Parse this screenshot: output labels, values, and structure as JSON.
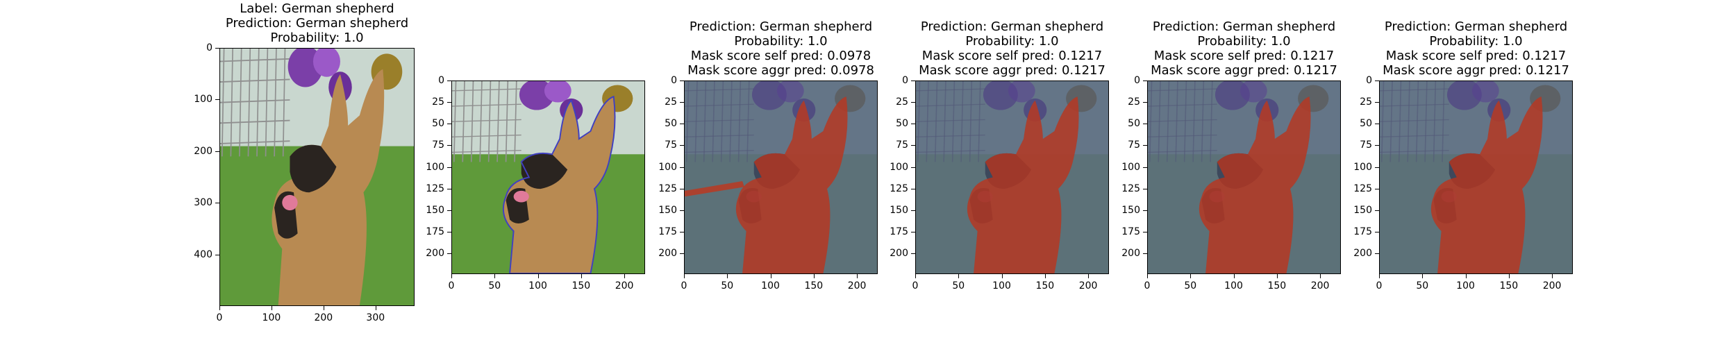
{
  "panels": [
    {
      "title_lines": [
        "Label: German shepherd",
        "Prediction: German shepherd",
        "Probability: 1.0"
      ],
      "x_ticks": [
        "0",
        "100",
        "200",
        "300"
      ],
      "x_tick_values": [
        0,
        100,
        200,
        300
      ],
      "x_max": 375,
      "y_ticks": [
        "0",
        "100",
        "200",
        "300",
        "400"
      ],
      "y_tick_values": [
        0,
        100,
        200,
        300,
        400
      ],
      "y_max": 500,
      "overlay": "none"
    },
    {
      "title_lines": [],
      "x_ticks": [
        "0",
        "50",
        "100",
        "150",
        "200"
      ],
      "x_tick_values": [
        0,
        50,
        100,
        150,
        200
      ],
      "x_max": 224,
      "y_ticks": [
        "0",
        "25",
        "50",
        "75",
        "100",
        "125",
        "150",
        "175",
        "200"
      ],
      "y_tick_values": [
        0,
        25,
        50,
        75,
        100,
        125,
        150,
        175,
        200
      ],
      "y_max": 224,
      "overlay": "edges"
    },
    {
      "title_lines": [
        "Prediction: German shepherd",
        "Probability: 1.0",
        "Mask score self pred: 0.0978",
        "Mask score aggr pred: 0.0978"
      ],
      "x_ticks": [
        "0",
        "50",
        "100",
        "150",
        "200"
      ],
      "x_tick_values": [
        0,
        50,
        100,
        150,
        200
      ],
      "x_max": 224,
      "y_ticks": [
        "0",
        "25",
        "50",
        "75",
        "100",
        "125",
        "150",
        "175",
        "200"
      ],
      "y_tick_values": [
        0,
        25,
        50,
        75,
        100,
        125,
        150,
        175,
        200
      ],
      "y_max": 224,
      "overlay": "mask-leash"
    },
    {
      "title_lines": [
        "Prediction: German shepherd",
        "Probability: 1.0",
        "Mask score self pred: 0.1217",
        "Mask score aggr pred: 0.1217"
      ],
      "x_ticks": [
        "0",
        "50",
        "100",
        "150",
        "200"
      ],
      "x_tick_values": [
        0,
        50,
        100,
        150,
        200
      ],
      "x_max": 224,
      "y_ticks": [
        "0",
        "25",
        "50",
        "75",
        "100",
        "125",
        "150",
        "175",
        "200"
      ],
      "y_tick_values": [
        0,
        25,
        50,
        75,
        100,
        125,
        150,
        175,
        200
      ],
      "y_max": 224,
      "overlay": "mask"
    },
    {
      "title_lines": [
        "Prediction: German shepherd",
        "Probability: 1.0",
        "Mask score self pred: 0.1217",
        "Mask score aggr pred: 0.1217"
      ],
      "x_ticks": [
        "0",
        "50",
        "100",
        "150",
        "200"
      ],
      "x_tick_values": [
        0,
        50,
        100,
        150,
        200
      ],
      "x_max": 224,
      "y_ticks": [
        "0",
        "25",
        "50",
        "75",
        "100",
        "125",
        "150",
        "175",
        "200"
      ],
      "y_tick_values": [
        0,
        25,
        50,
        75,
        100,
        125,
        150,
        175,
        200
      ],
      "y_max": 224,
      "overlay": "mask"
    },
    {
      "title_lines": [
        "Prediction: German shepherd",
        "Probability: 1.0",
        "Mask score self pred: 0.1217",
        "Mask score aggr pred: 0.1217"
      ],
      "x_ticks": [
        "0",
        "50",
        "100",
        "150",
        "200"
      ],
      "x_tick_values": [
        0,
        50,
        100,
        150,
        200
      ],
      "x_max": 224,
      "y_ticks": [
        "0",
        "25",
        "50",
        "75",
        "100",
        "125",
        "150",
        "175",
        "200"
      ],
      "y_tick_values": [
        0,
        25,
        50,
        75,
        100,
        125,
        150,
        175,
        200
      ],
      "y_max": 224,
      "overlay": "mask"
    }
  ],
  "colors": {
    "grass": "#5f9a3a",
    "fence": "#8f8f8f",
    "purple": "#7b3fa8",
    "dog_tan": "#b88a52",
    "dog_black": "#2a2420",
    "mask_red": "#c0361c",
    "mask_bg": "#1f2a63",
    "edge": "#4040c0"
  }
}
